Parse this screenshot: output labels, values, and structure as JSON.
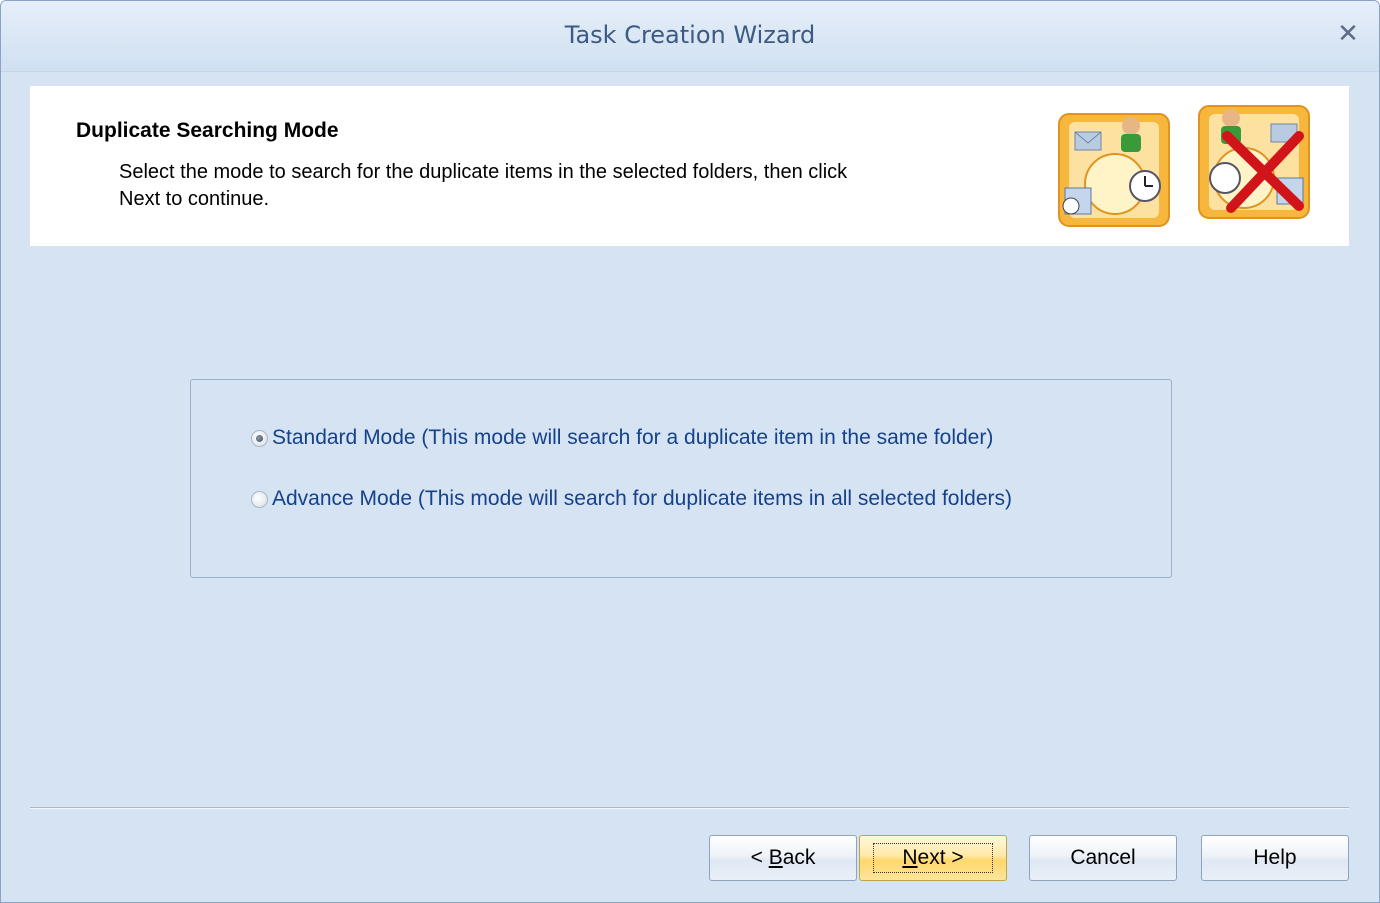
{
  "window": {
    "title": "Task Creation Wizard",
    "close_label": "✕"
  },
  "header": {
    "title": "Duplicate Searching Mode",
    "description": "Select the mode to search for the duplicate items in the selected folders, then click Next to continue."
  },
  "modes": [
    {
      "label": "Standard Mode (This mode will search for a duplicate item in the same folder)",
      "checked": true
    },
    {
      "label": "Advance Mode (This mode will search for duplicate items in all selected folders)",
      "checked": false
    }
  ],
  "buttons": {
    "back": {
      "prefix": "< ",
      "mnemonic": "B",
      "rest": "ack"
    },
    "next": {
      "mnemonic": "N",
      "rest": "ext >"
    },
    "cancel": "Cancel",
    "help": "Help"
  },
  "icons": {
    "header_art": "outlook-items-duplicate-removal-icon"
  },
  "colors": {
    "title_text": "#3c5a82",
    "radio_text": "#15428b",
    "background": "#d5e3f2",
    "next_highlight": "#ffd86b"
  }
}
